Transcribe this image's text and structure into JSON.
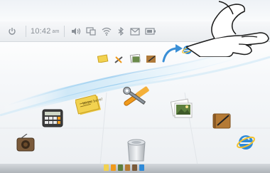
{
  "status_bar": {
    "time": "10:42",
    "ampm": "am",
    "icons": [
      "power-icon",
      "volume-icon",
      "display-icon",
      "wifi-icon",
      "bluetooth-icon",
      "mail-icon",
      "battery-icon"
    ]
  },
  "desktop": {
    "row_far": [
      "notes-icon",
      "tools-icon",
      "photos-icon",
      "pen-icon"
    ],
    "row_mid": [
      "calculator-icon",
      "notes-icon",
      "tools-icon",
      "photos-icon",
      "address-book-icon"
    ],
    "row_near": [
      "radio-icon",
      "trash-icon",
      "browser-icon"
    ],
    "note_label": "Write here!",
    "browser_icon_note": "browser-icon"
  },
  "gesture": {
    "type": "swipe",
    "icon": "hand-icon",
    "arrow": "curved-arrow-icon"
  },
  "dock": {
    "icons": [
      "notes-icon",
      "tools-icon",
      "photos-icon",
      "pen-icon",
      "radio-icon",
      "browser-icon"
    ]
  },
  "colors": {
    "accent_blue": "#3a8fd6",
    "swoosh": "#9fd0f0",
    "note_yellow": "#f2d250",
    "tools_orange": "#f09a1c"
  }
}
